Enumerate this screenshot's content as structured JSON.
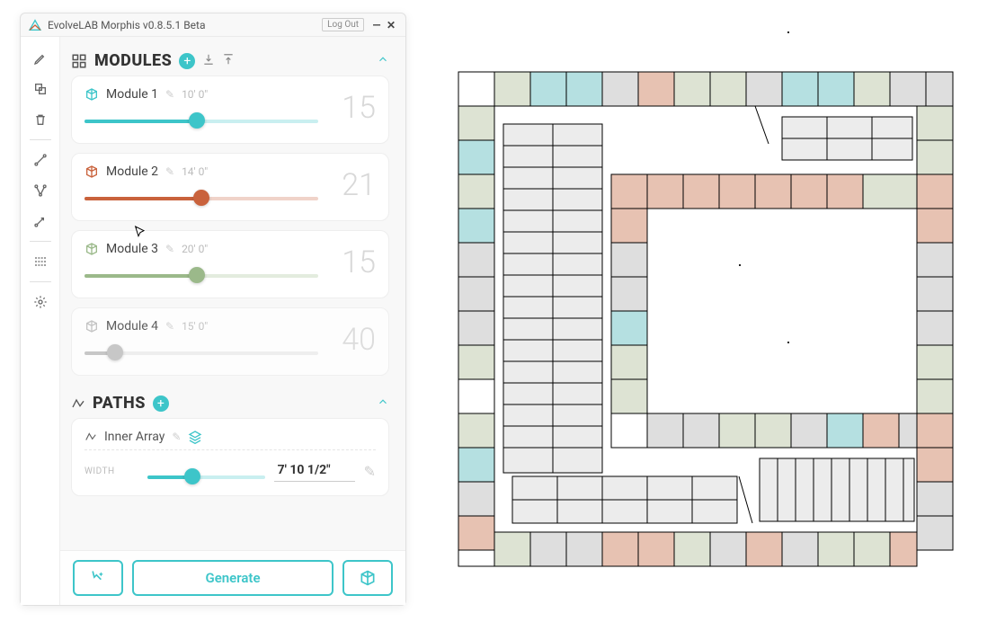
{
  "titlebar": {
    "title": "EvolveLAB Morphis v0.8.5.1 Beta",
    "logout": "Log Out"
  },
  "sections": {
    "modules": {
      "title": "MODULES"
    },
    "paths": {
      "title": "PATHS"
    }
  },
  "modules": [
    {
      "name": "Module 1",
      "dims": "10'  0\"",
      "count": "15",
      "color": "#3dc5c9",
      "fill": 48,
      "active": true
    },
    {
      "name": "Module 2",
      "dims": "14'  0\"",
      "count": "21",
      "color": "#c9623c",
      "fill": 50,
      "active": true
    },
    {
      "name": "Module 3",
      "dims": "20'  0\"",
      "count": "15",
      "color": "#9bb98a",
      "fill": 48,
      "active": true
    },
    {
      "name": "Module 4",
      "dims": "15'  0\"",
      "count": "40",
      "color": "#bfbfbf",
      "fill": 13,
      "active": false
    }
  ],
  "paths": [
    {
      "name": "Inner Array",
      "width_label": "WIDTH",
      "width_value": "7'  10 1/2\"",
      "slider_fill": 38
    }
  ],
  "footer": {
    "generate": "Generate"
  },
  "colors": {
    "teal": "#3dc5c9"
  }
}
